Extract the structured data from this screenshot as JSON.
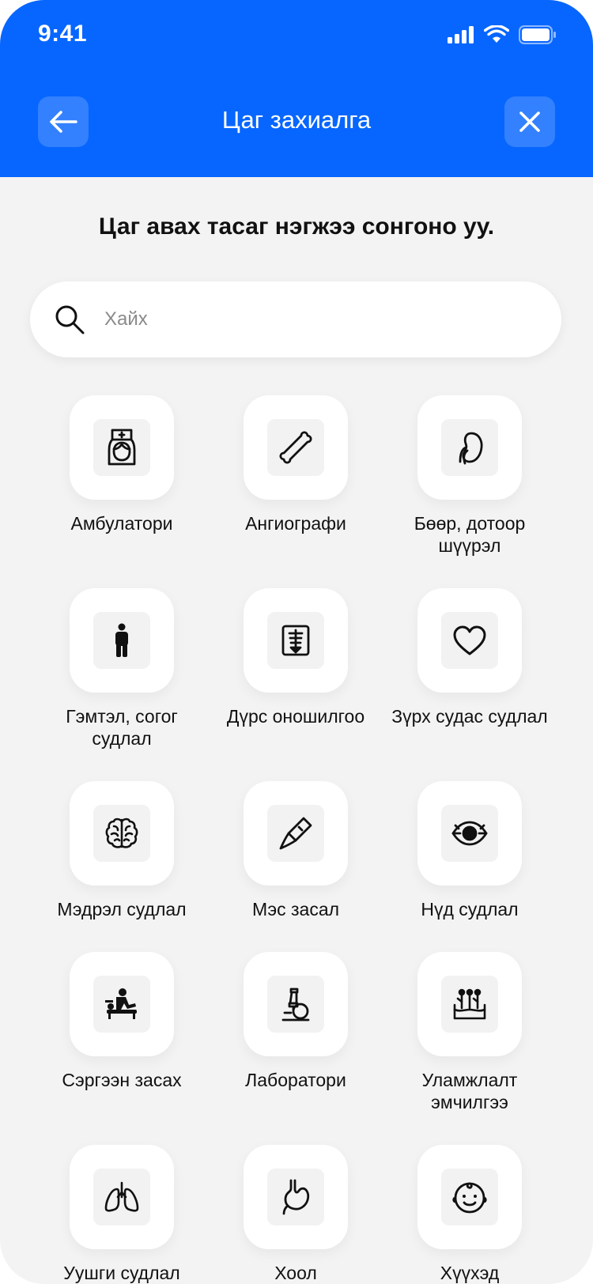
{
  "status_bar": {
    "time": "9:41"
  },
  "header": {
    "title": "Цаг захиалга"
  },
  "prompt": "Цаг авах тасаг нэгжээ сонгоно уу.",
  "search": {
    "placeholder": "Хайх"
  },
  "categories": [
    {
      "label": "Амбулатори",
      "icon": "nurse-icon"
    },
    {
      "label": "Ангиографи",
      "icon": "bone-icon"
    },
    {
      "label": "Бөөр, дотоор шүүрэл",
      "icon": "kidney-icon"
    },
    {
      "label": "Гэмтэл, согог судлал",
      "icon": "person-icon"
    },
    {
      "label": "Дүрс оношилгоо",
      "icon": "xray-icon"
    },
    {
      "label": "Зүрх судас судлал",
      "icon": "heart-icon"
    },
    {
      "label": "Мэдрэл судлал",
      "icon": "brain-icon"
    },
    {
      "label": "Мэс засал",
      "icon": "scalpel-icon"
    },
    {
      "label": "Нүд судлал",
      "icon": "eye-icon"
    },
    {
      "label": "Сэргээн засах",
      "icon": "massage-icon"
    },
    {
      "label": "Лаборатори",
      "icon": "microscope-icon"
    },
    {
      "label": "Уламжлалт эмчилгээ",
      "icon": "acupuncture-icon"
    },
    {
      "label": "Уушги судлал",
      "icon": "lungs-icon"
    },
    {
      "label": "Хоол",
      "icon": "stomach-icon"
    },
    {
      "label": "Хүүхэд",
      "icon": "baby-icon"
    }
  ]
}
